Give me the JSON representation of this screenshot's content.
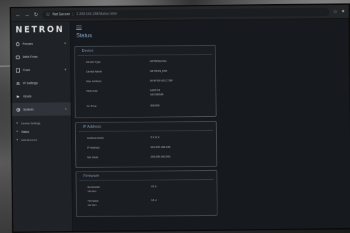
{
  "browser": {
    "security_label": "Not Secure",
    "url": "2.200.166.238/Status.html"
  },
  "app": {
    "logo": "NETRON"
  },
  "sidebar": {
    "items": [
      {
        "label": "Presets",
        "icon": "gear-icon",
        "expandable": true
      },
      {
        "label": "DMX Ports",
        "icon": "port-icon",
        "expandable": false
      },
      {
        "label": "Cues",
        "icon": "list-icon",
        "expandable": true
      },
      {
        "label": "IP Settings",
        "icon": "network-icon",
        "expandable": false
      },
      {
        "label": "Inputs",
        "icon": "input-icon",
        "expandable": false
      },
      {
        "label": "System",
        "icon": "gear-icon",
        "expandable": true
      }
    ],
    "subitems": [
      {
        "label": "Device Settings"
      },
      {
        "label": "Status"
      },
      {
        "label": "Maintenance"
      }
    ]
  },
  "main": {
    "title": "Status",
    "device": {
      "title": "Device",
      "rows": [
        {
          "label": "Device Type",
          "value": "NETRON EN4"
        },
        {
          "label": "Device Name",
          "value": "NETRON_EN4"
        },
        {
          "label": "Mac Address",
          "value": "40:4F:E4:4D:C7:BF"
        },
        {
          "label": "RDM UID",
          "value": "5A22:FB",
          "value2": "0A1:0B0A6"
        },
        {
          "label": "On Time",
          "value": "0h0:02h"
        }
      ]
    },
    "ip": {
      "title": "IP Address",
      "rows": [
        {
          "label": "Address Mode",
          "value": "2.X.X.X"
        },
        {
          "label": "IP Address",
          "value": "002.200.166.238"
        },
        {
          "label": "Net Mask",
          "value": "255.000.000.000"
        }
      ]
    },
    "firmware": {
      "title": "Firmware",
      "rows": [
        {
          "label": "Bootloader",
          "label2": "Version",
          "value": "V1.4"
        },
        {
          "label": "Firmware",
          "label2": "Version",
          "value": "V1.4"
        }
      ]
    }
  }
}
